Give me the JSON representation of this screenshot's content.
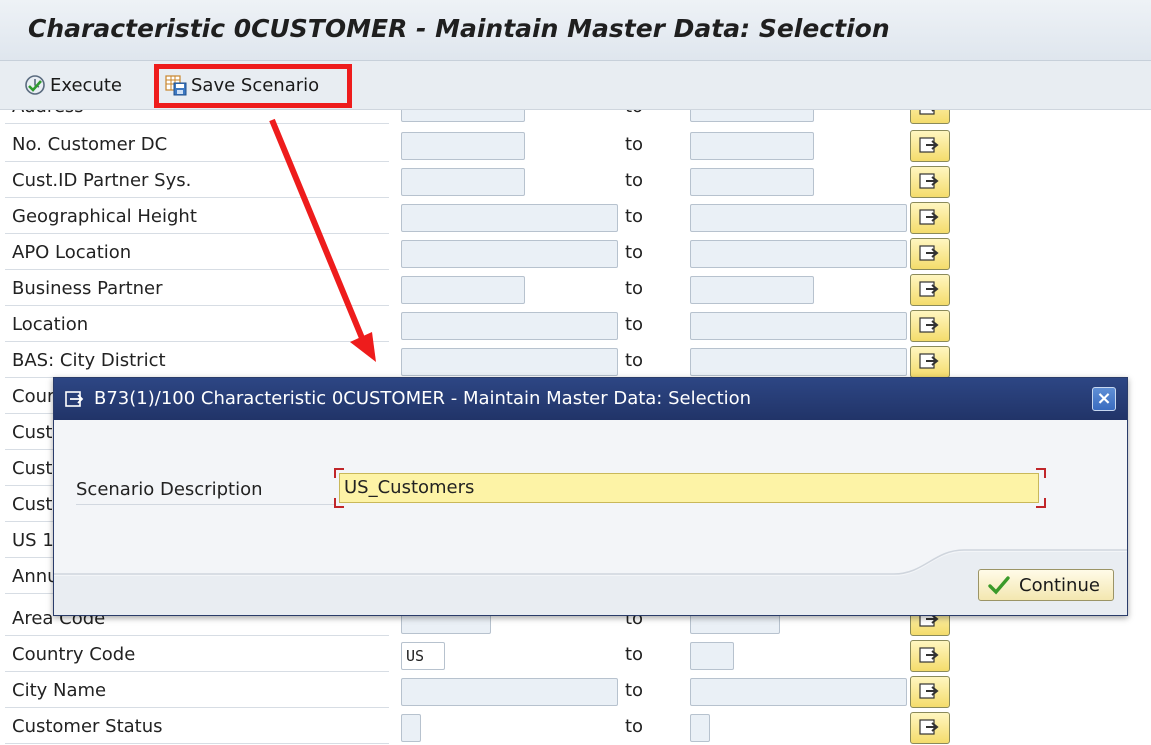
{
  "window": {
    "title": "Characteristic 0CUSTOMER - Maintain Master Data: Selection"
  },
  "toolbar": {
    "execute_label": "Execute",
    "save_scenario_label": "Save Scenario"
  },
  "form": {
    "to_label": "to",
    "rows": [
      {
        "label": "Address",
        "from_value": "",
        "to_value": ""
      },
      {
        "label": "No. Customer DC",
        "from_value": "",
        "to_value": ""
      },
      {
        "label": "Cust.ID Partner Sys.",
        "from_value": "",
        "to_value": ""
      },
      {
        "label": "Geographical Height",
        "from_value": "",
        "to_value": ""
      },
      {
        "label": "APO Location",
        "from_value": "",
        "to_value": ""
      },
      {
        "label": "Business Partner",
        "from_value": "",
        "to_value": ""
      },
      {
        "label": "Location",
        "from_value": "",
        "to_value": ""
      },
      {
        "label": "BAS: City District",
        "from_value": "",
        "to_value": ""
      },
      {
        "label": "Cour",
        "from_value": "",
        "to_value": ""
      },
      {
        "label": "Cust",
        "from_value": "",
        "to_value": ""
      },
      {
        "label": "Cust",
        "from_value": "",
        "to_value": ""
      },
      {
        "label": "Cust",
        "from_value": "",
        "to_value": ""
      },
      {
        "label": "US 1",
        "from_value": "",
        "to_value": ""
      },
      {
        "label": "Annu",
        "from_value": "",
        "to_value": ""
      },
      {
        "label": "Area Code",
        "from_value": "",
        "to_value": ""
      },
      {
        "label": "Country Code",
        "from_value": "US",
        "to_value": ""
      },
      {
        "label": "City Name",
        "from_value": "",
        "to_value": ""
      },
      {
        "label": "Customer Status",
        "from_value": "",
        "to_value": ""
      }
    ]
  },
  "dialog": {
    "title": "B73(1)/100 Characteristic 0CUSTOMER - Maintain Master Data: Selection",
    "field_label": "Scenario Description",
    "field_value": "US_Customers",
    "continue_label": "Continue",
    "close_glyph": "×"
  },
  "colors": {
    "highlight": "#ee1c1c",
    "dialog_title_bg": "#213468",
    "input_required_bg": "#fdf3a6",
    "selection_button": "#f4dc6c"
  },
  "icons": {
    "execute": "clock-check-icon",
    "save_scenario": "save-grid-icon",
    "multiple_selection": "multiple-selection-arrow-icon",
    "dialog": "dialog-window-icon",
    "continue": "green-checkmark-icon"
  }
}
